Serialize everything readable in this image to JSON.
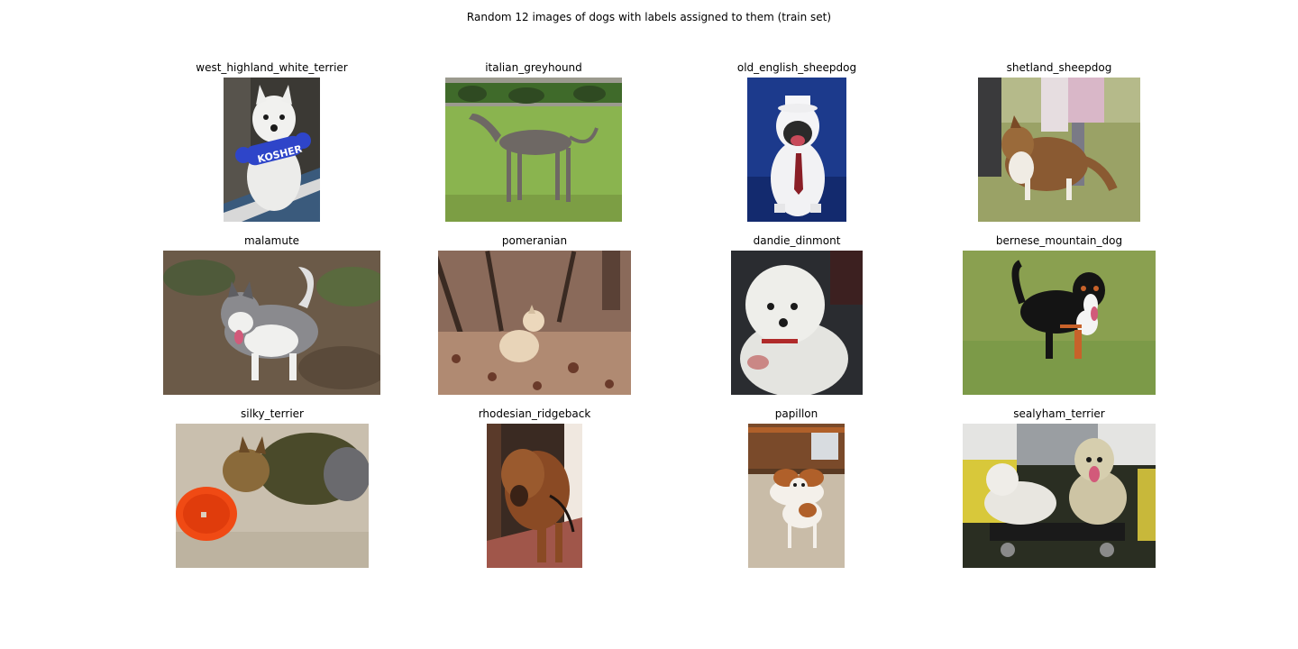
{
  "figure": {
    "title": "Random 12 images of dogs with labels assigned to them (train set)"
  },
  "panels": [
    {
      "label": "west_highland_white_terrier",
      "palette": {
        "bg": "#3b3934",
        "main": "#ececea",
        "accent": "#2e45c9",
        "ground": "#3a5a7c"
      }
    },
    {
      "label": "italian_greyhound",
      "palette": {
        "bg": "#7fa34a",
        "main": "#6e6864",
        "accent": "#2f4a22",
        "ground": "#8ab44f"
      }
    },
    {
      "label": "old_english_sheepdog",
      "palette": {
        "bg": "#1c3a8c",
        "main": "#f2f2f4",
        "accent": "#2a2a2a",
        "ground": "#132a6e"
      }
    },
    {
      "label": "shetland_sheepdog",
      "palette": {
        "bg": "#8e9a5a",
        "main": "#8a5a32",
        "accent": "#d9b7c8",
        "ground": "#9aa266"
      }
    },
    {
      "label": "malamute",
      "palette": {
        "bg": "#6b5a48",
        "main": "#8a8a8e",
        "accent": "#f0f0ee",
        "ground": "#4f5a3a"
      }
    },
    {
      "label": "pomeranian",
      "palette": {
        "bg": "#5a4136",
        "main": "#e8d4b8",
        "accent": "#b08a72",
        "ground": "#8a6a5a"
      }
    },
    {
      "label": "dandie_dinmont",
      "palette": {
        "bg": "#2a2c30",
        "main": "#eeeeea",
        "accent": "#b02a2a",
        "ground": "#3c3c40"
      }
    },
    {
      "label": "bernese_mountain_dog",
      "palette": {
        "bg": "#8aa050",
        "main": "#141414",
        "accent": "#c8622a",
        "ground": "#7c9a48"
      }
    },
    {
      "label": "silky_terrier",
      "palette": {
        "bg": "#c9bfae",
        "main": "#4a4a2a",
        "accent": "#f04a14",
        "ground": "#bdb3a0"
      }
    },
    {
      "label": "rhodesian_ridgeback",
      "palette": {
        "bg": "#3a2a22",
        "main": "#8a4a24",
        "accent": "#c8705a",
        "ground": "#a0564a"
      }
    },
    {
      "label": "papillon",
      "palette": {
        "bg": "#7a4a2a",
        "main": "#f4f0ea",
        "accent": "#b0602a",
        "ground": "#c9bca8"
      }
    },
    {
      "label": "sealyham_terrier",
      "palette": {
        "bg": "#2a2e22",
        "main": "#e8e6e0",
        "accent": "#d8c83a",
        "ground": "#3a3a34"
      }
    }
  ]
}
